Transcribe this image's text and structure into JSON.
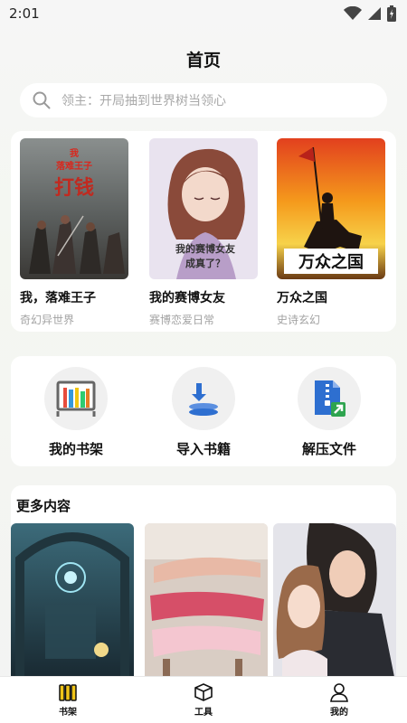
{
  "status_bar": {
    "time": "2:01"
  },
  "header": {
    "title": "首页"
  },
  "search": {
    "placeholder": "领主：开局抽到世界树当领心"
  },
  "featured_books": [
    {
      "title": "我，落难王子",
      "genre": "奇幻异世界",
      "cover_text": "我，落难王子 打钱"
    },
    {
      "title": "我的赛博女友",
      "genre": "赛博恋爱日常",
      "cover_text": "我的赛博女友成真了？"
    },
    {
      "title": "万众之国",
      "genre": "史诗玄幻",
      "cover_text": "万众之国"
    }
  ],
  "tools": [
    {
      "label": "我的书架",
      "icon": "bookshelf-icon"
    },
    {
      "label": "导入书籍",
      "icon": "import-icon"
    },
    {
      "label": "解压文件",
      "icon": "unzip-file-icon"
    }
  ],
  "more": {
    "title": "更多内容"
  },
  "bottom_nav": [
    {
      "label": "书架",
      "icon": "bookshelf-icon",
      "active": true
    },
    {
      "label": "工具",
      "icon": "box-icon",
      "active": false
    },
    {
      "label": "我的",
      "icon": "person-icon",
      "active": false
    }
  ],
  "colors": {
    "accent": "#f0c419",
    "blue": "#2e6fd0",
    "green": "#2ea44f"
  }
}
